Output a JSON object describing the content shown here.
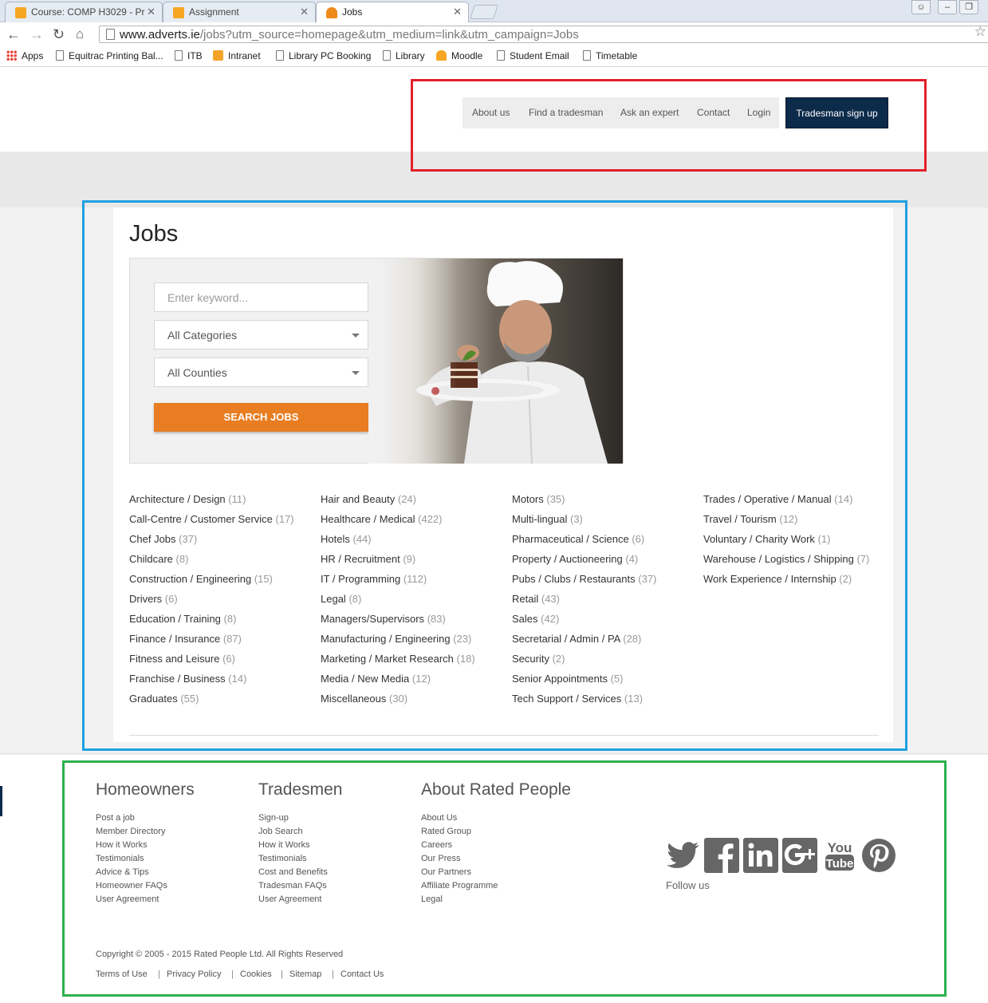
{
  "browser": {
    "tabs": [
      {
        "title": "Course: COMP H3029 - Pr"
      },
      {
        "title": "Assignment"
      },
      {
        "title": "Jobs"
      }
    ],
    "url_host": "www.adverts.ie",
    "url_path": "/jobs?utm_source=homepage&utm_medium=link&utm_campaign=Jobs",
    "bookmarks": [
      "Apps",
      "Equitrac Printing Bal...",
      "ITB",
      "Intranet",
      "Library PC Booking",
      "Library",
      "Moodle",
      "Student Email",
      "Timetable"
    ]
  },
  "nav": {
    "links": [
      "About us",
      "Find a tradesman",
      "Ask an expert",
      "Contact",
      "Login"
    ],
    "signup": "Tradesman sign up"
  },
  "page": {
    "title": "Jobs",
    "keyword_placeholder": "Enter keyword...",
    "category_select": "All Categories",
    "county_select": "All Counties",
    "search_button": "SEARCH JOBS"
  },
  "categories": [
    [
      {
        "name": "Architecture / Design",
        "count": "(11)"
      },
      {
        "name": "Call-Centre / Customer Service",
        "count": "(17)"
      },
      {
        "name": "Chef Jobs",
        "count": "(37)"
      },
      {
        "name": "Childcare",
        "count": "(8)"
      },
      {
        "name": "Construction / Engineering",
        "count": "(15)"
      },
      {
        "name": "Drivers",
        "count": "(6)"
      },
      {
        "name": "Education / Training",
        "count": "(8)"
      },
      {
        "name": "Finance / Insurance",
        "count": "(87)"
      },
      {
        "name": "Fitness and Leisure",
        "count": "(6)"
      },
      {
        "name": "Franchise / Business",
        "count": "(14)"
      },
      {
        "name": "Graduates",
        "count": "(55)"
      }
    ],
    [
      {
        "name": "Hair and Beauty",
        "count": "(24)"
      },
      {
        "name": "Healthcare / Medical",
        "count": "(422)"
      },
      {
        "name": "Hotels",
        "count": "(44)"
      },
      {
        "name": "HR / Recruitment",
        "count": "(9)"
      },
      {
        "name": "IT / Programming",
        "count": "(112)"
      },
      {
        "name": "Legal",
        "count": "(8)"
      },
      {
        "name": "Managers/Supervisors",
        "count": "(83)"
      },
      {
        "name": "Manufacturing / Engineering",
        "count": "(23)"
      },
      {
        "name": "Marketing / Market Research",
        "count": "(18)"
      },
      {
        "name": "Media / New Media",
        "count": "(12)"
      },
      {
        "name": "Miscellaneous",
        "count": "(30)"
      }
    ],
    [
      {
        "name": "Motors",
        "count": "(35)"
      },
      {
        "name": "Multi-lingual",
        "count": "(3)"
      },
      {
        "name": "Pharmaceutical / Science",
        "count": "(6)"
      },
      {
        "name": "Property / Auctioneering",
        "count": "(4)"
      },
      {
        "name": "Pubs / Clubs / Restaurants",
        "count": "(37)"
      },
      {
        "name": "Retail",
        "count": "(43)"
      },
      {
        "name": "Sales",
        "count": "(42)"
      },
      {
        "name": "Secretarial / Admin / PA",
        "count": "(28)"
      },
      {
        "name": "Security",
        "count": "(2)"
      },
      {
        "name": "Senior Appointments",
        "count": "(5)"
      },
      {
        "name": "Tech Support / Services",
        "count": "(13)"
      }
    ],
    [
      {
        "name": "Trades / Operative / Manual",
        "count": "(14)"
      },
      {
        "name": "Travel / Tourism",
        "count": "(12)"
      },
      {
        "name": "Voluntary / Charity Work",
        "count": "(1)"
      },
      {
        "name": "Warehouse / Logistics / Shipping",
        "count": "(7)"
      },
      {
        "name": "Work Experience / Internship",
        "count": "(2)"
      }
    ]
  ],
  "footer": {
    "columns": [
      {
        "heading": "Homeowners",
        "links": [
          "Post a job",
          "Member Directory",
          "How it Works",
          "Testimonials",
          "Advice & Tips",
          "Homeowner FAQs",
          "User Agreement"
        ]
      },
      {
        "heading": "Tradesmen",
        "links": [
          "Sign-up",
          "Job Search",
          "How it Works",
          "Testimonials",
          "Cost and Benefits",
          "Tradesman FAQs",
          "User Agreement"
        ]
      },
      {
        "heading": "About Rated People",
        "links": [
          "About Us",
          "Rated Group",
          "Careers",
          "Our Press",
          "Our Partners",
          "Affiliate Programme",
          "Legal"
        ]
      }
    ],
    "social": [
      "twitter-icon",
      "facebook-icon",
      "linkedin-icon",
      "googleplus-icon",
      "youtube-icon",
      "pinterest-icon"
    ],
    "follow_label": "Follow us",
    "copyright": "Copyright © 2005 - 2015 Rated People Ltd. All Rights Reserved",
    "legal_links": [
      "Terms of Use",
      "Privacy Policy",
      "Cookies",
      "Sitemap",
      "Contact Us"
    ]
  },
  "colors": {
    "annot_red": "#e3202a",
    "annot_blue": "#1ea1e1",
    "annot_green": "#2bb24c",
    "signup_bg": "#0c2a4a",
    "search_btn": "#e87d22"
  }
}
